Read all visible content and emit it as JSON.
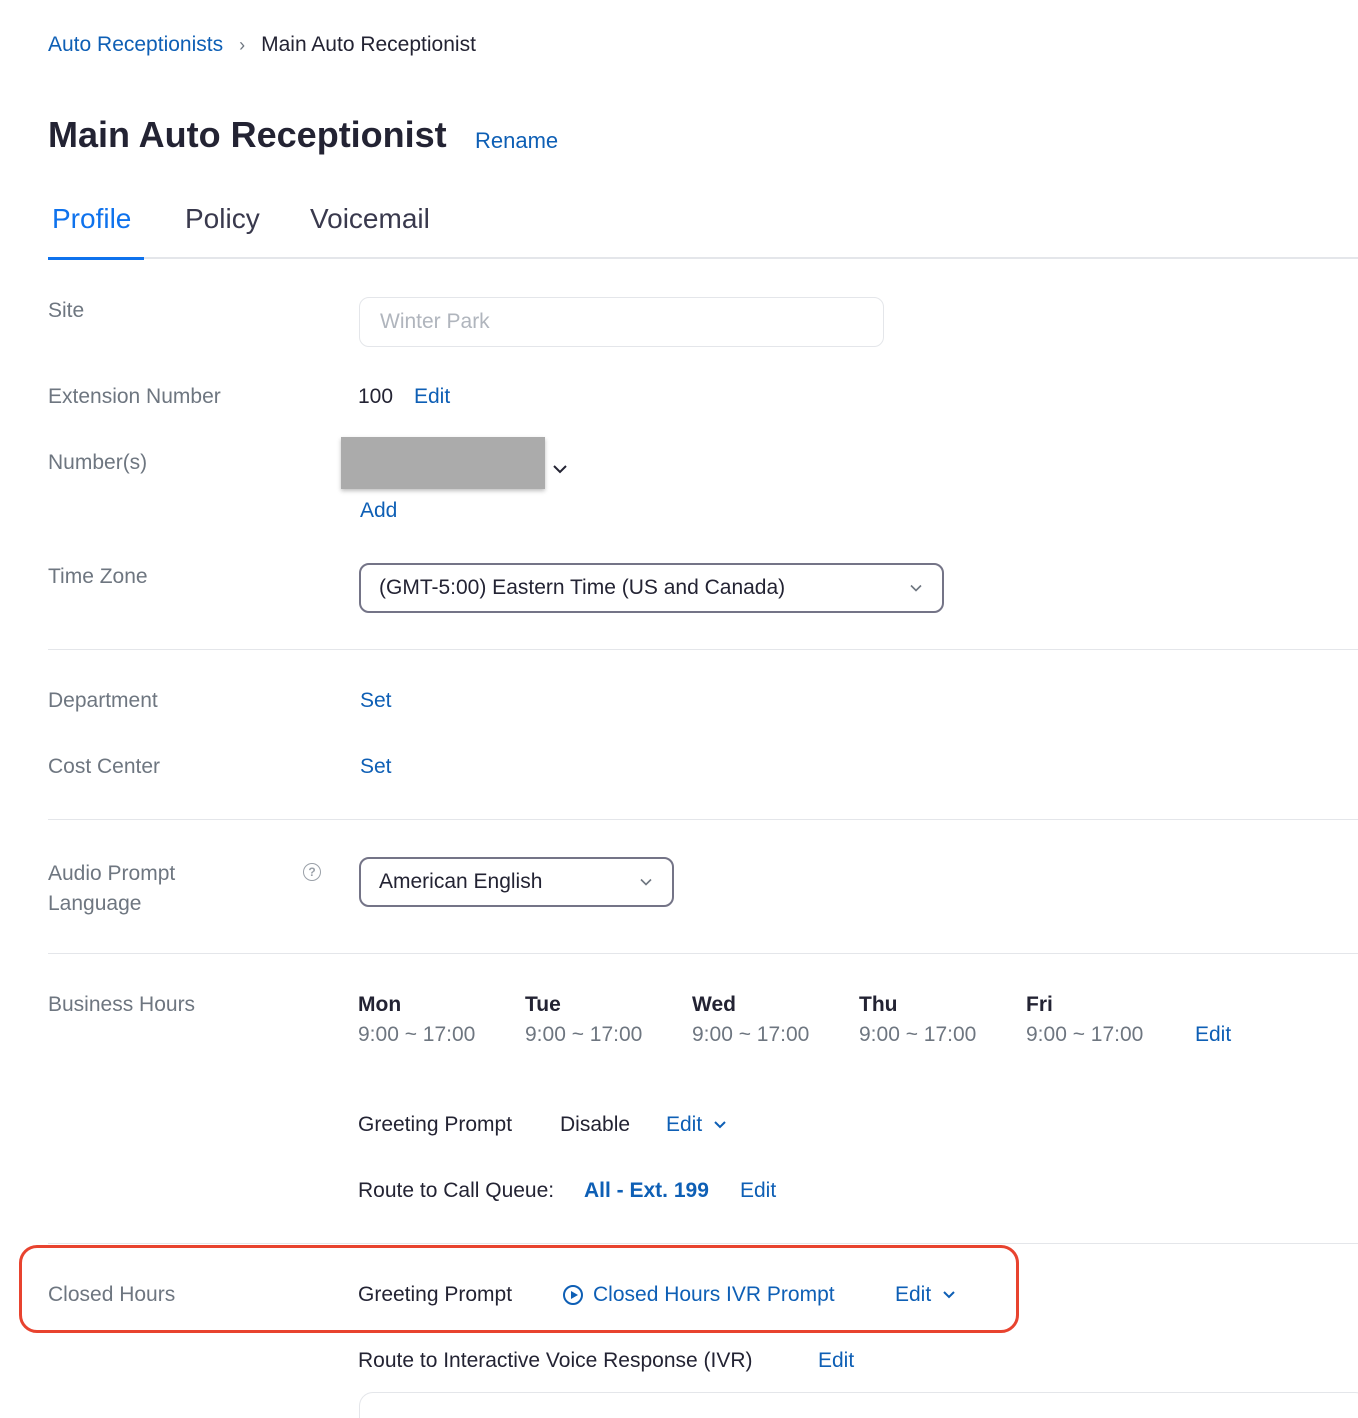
{
  "breadcrumb": {
    "parent": "Auto Receptionists",
    "separator": "›",
    "current": "Main Auto Receptionist"
  },
  "page": {
    "title": "Main Auto Receptionist",
    "rename_label": "Rename"
  },
  "tabs": [
    {
      "label": "Profile",
      "active": true
    },
    {
      "label": "Policy",
      "active": false
    },
    {
      "label": "Voicemail",
      "active": false
    }
  ],
  "site": {
    "label": "Site",
    "placeholder": "Winter Park"
  },
  "extension": {
    "label": "Extension Number",
    "value": "100",
    "edit_label": "Edit"
  },
  "numbers": {
    "label": "Number(s)",
    "add_label": "Add"
  },
  "time_zone": {
    "label": "Time Zone",
    "value": "(GMT-5:00) Eastern Time (US and Canada)"
  },
  "department": {
    "label": "Department",
    "set_label": "Set"
  },
  "cost_center": {
    "label": "Cost Center",
    "set_label": "Set"
  },
  "audio_prompt": {
    "label_line1": "Audio Prompt",
    "label_line2": "Language",
    "help_icon": "?",
    "value": "American English"
  },
  "business_hours": {
    "label": "Business Hours",
    "days": [
      {
        "day": "Mon",
        "hours": "9:00 ~ 17:00"
      },
      {
        "day": "Tue",
        "hours": "9:00 ~ 17:00"
      },
      {
        "day": "Wed",
        "hours": "9:00 ~ 17:00"
      },
      {
        "day": "Thu",
        "hours": "9:00 ~ 17:00"
      },
      {
        "day": "Fri",
        "hours": "9:00 ~ 17:00"
      }
    ],
    "edit_label": "Edit",
    "greeting_label": "Greeting Prompt",
    "greeting_value": "Disable",
    "greeting_edit": "Edit",
    "route_label": "Route to Call Queue:",
    "route_value": "All - Ext. 199",
    "route_edit": "Edit"
  },
  "closed_hours": {
    "label": "Closed Hours",
    "greeting_label": "Greeting Prompt",
    "greeting_value": "Closed Hours IVR Prompt",
    "greeting_edit": "Edit",
    "route_label": "Route to Interactive Voice Response (IVR)",
    "route_edit": "Edit"
  },
  "colors": {
    "link": "#0e5fb5",
    "tab_active": "#0e72ed",
    "highlight": "#e8432f"
  },
  "icons": [
    "chevron-right-icon",
    "chevron-down-icon",
    "help-circle-icon",
    "play-circle-icon"
  ]
}
